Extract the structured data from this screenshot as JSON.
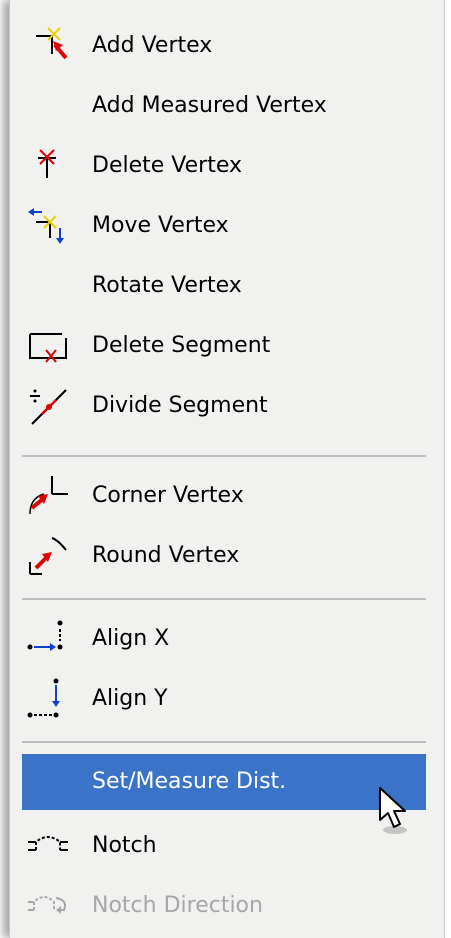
{
  "menu": {
    "items": [
      {
        "label": "Add Vertex",
        "icon": "add-vertex-icon"
      },
      {
        "label": "Add Measured Vertex",
        "icon": null
      },
      {
        "label": "Delete Vertex",
        "icon": "delete-vertex-icon"
      },
      {
        "label": "Move Vertex",
        "icon": "move-vertex-icon"
      },
      {
        "label": "Rotate Vertex",
        "icon": null
      },
      {
        "label": "Delete Segment",
        "icon": "delete-segment-icon"
      },
      {
        "label": "Divide Segment",
        "icon": "divide-segment-icon"
      },
      {
        "label": "Corner Vertex",
        "icon": "corner-vertex-icon"
      },
      {
        "label": "Round Vertex",
        "icon": "round-vertex-icon"
      },
      {
        "label": "Align X",
        "icon": "align-x-icon"
      },
      {
        "label": "Align Y",
        "icon": "align-y-icon"
      },
      {
        "label": "Set/Measure Dist.",
        "icon": null,
        "state": "highlighted"
      },
      {
        "label": "Notch",
        "icon": "notch-icon"
      },
      {
        "label": "Notch Direction",
        "icon": "notch-direction-icon",
        "state": "disabled"
      }
    ]
  },
  "colors": {
    "menu_background": "#f1f1ef",
    "highlight": "#3b73c8",
    "highlight_text": "#ffffff",
    "disabled_text": "#a6a6a6",
    "separator": "#bdbdbd"
  }
}
